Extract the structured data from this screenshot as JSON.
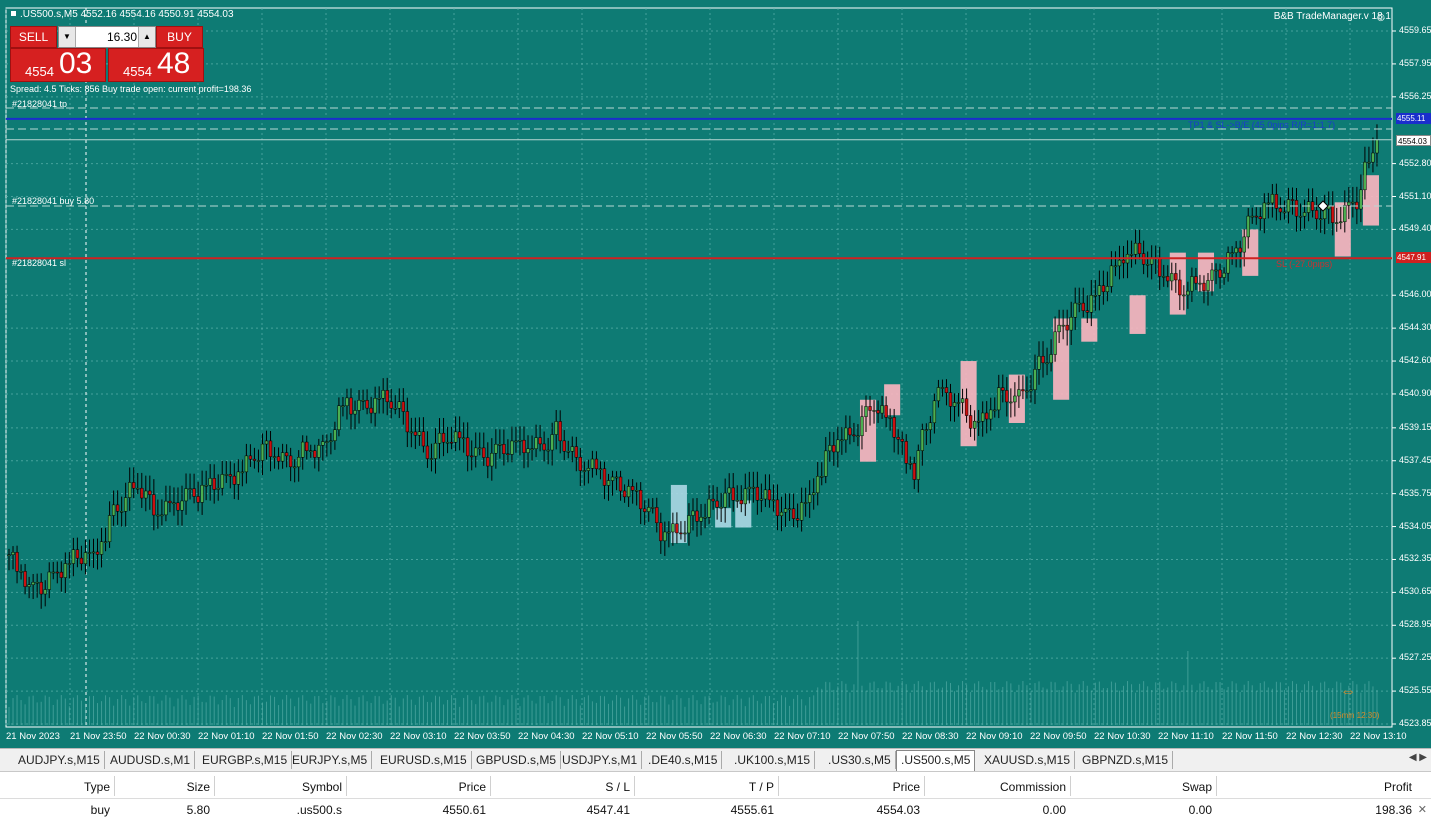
{
  "header": {
    "symbol_info": ".US500.s,M5  4552.16 4554.16 4550.91 4554.03",
    "trade_manager": "B&B TradeManager.v 18.1"
  },
  "one_click": {
    "sell_label": "SELL",
    "buy_label": "BUY",
    "volume": "16.30",
    "sell_price_small": "4554",
    "sell_price_big": "03",
    "buy_price_small": "4554",
    "buy_price_big": "48"
  },
  "status_line": "Spread: 4.5  Ticks: 856  Buy trade open: current profit=198.36",
  "line_labels": {
    "tp": "#21828041 tp",
    "buy": "#21828041 buy 5.80",
    "sl": "#21828041 sl",
    "tp_note": "TP1 & SL->B/E (45.0pips R/R=1:1.7)",
    "sl_note": "SL (-27.0pips)"
  },
  "price_tags": {
    "tp": "4555.11",
    "current": "4554.03",
    "sl": "4547.91"
  },
  "y_axis": [
    "4559.65",
    "4557.95",
    "4556.25",
    "4552.80",
    "4551.10",
    "4549.40",
    "4546.00",
    "4544.30",
    "4542.60",
    "4540.90",
    "4539.15",
    "4537.45",
    "4535.75",
    "4534.05",
    "4532.35",
    "4530.65",
    "4528.95",
    "4527.25",
    "4525.55",
    "4523.85"
  ],
  "x_axis": [
    "21 Nov 2023",
    "21 Nov 23:50",
    "22 Nov 00:30",
    "22 Nov 01:10",
    "22 Nov 01:50",
    "22 Nov 02:30",
    "22 Nov 03:10",
    "22 Nov 03:50",
    "22 Nov 04:30",
    "22 Nov 05:10",
    "22 Nov 05:50",
    "22 Nov 06:30",
    "22 Nov 07:10",
    "22 Nov 07:50",
    "22 Nov 08:30",
    "22 Nov 09:10",
    "22 Nov 09:50",
    "22 Nov 10:30",
    "22 Nov 11:10",
    "22 Nov 11:50",
    "22 Nov 12:30",
    "22 Nov 13:10"
  ],
  "corner_note": "(15min 12:30)",
  "colors": {
    "background": "#0e7b74",
    "bull": "#4caf50",
    "bear": "#cc1010",
    "tp_line": "#1a2ecc",
    "sl_line": "#d02020",
    "zone_pink": "#ffb6c1",
    "zone_blue": "#add8e6"
  },
  "tabs": [
    "AUDJPY.s,M15",
    "AUDUSD.s,M1",
    "EURGBP.s,M15",
    "EURJPY.s,M5",
    "EURUSD.s,M15",
    "GBPUSD.s,M5",
    "USDJPY.s,M1",
    ".DE40.s,M15",
    ".UK100.s,M15",
    ".US30.s,M5",
    ".US500.s,M5",
    "XAUUSD.s,M15",
    "GBPNZD.s,M15"
  ],
  "active_tab": ".US500.s,M5",
  "trade_table": {
    "headers": [
      "Type",
      "Size",
      "Symbol",
      "Price",
      "S / L",
      "T / P",
      "Price",
      "Commission",
      "Swap",
      "Profit"
    ],
    "row": [
      "buy",
      "5.80",
      ".us500.s",
      "4550.61",
      "4547.41",
      "4555.61",
      "4554.03",
      "0.00",
      "0.00",
      "198.36"
    ]
  },
  "chart_data": {
    "type": "candlestick",
    "y_range": [
      4523.85,
      4559.65
    ],
    "levels": {
      "tp": 4555.11,
      "current": 4554.03,
      "sl": 4547.91,
      "entry": 4550.61
    },
    "close_points": [
      [
        0,
        4532.3
      ],
      [
        4,
        4530.8
      ],
      [
        8,
        4531.6
      ],
      [
        12,
        4532.1
      ],
      [
        16,
        4532.4
      ],
      [
        20,
        4535.3
      ],
      [
        24,
        4535.8
      ],
      [
        28,
        4535.0
      ],
      [
        32,
        4535.6
      ],
      [
        36,
        4535.4
      ],
      [
        40,
        4536.4
      ],
      [
        44,
        4537.2
      ],
      [
        48,
        4537.8
      ],
      [
        52,
        4537.6
      ],
      [
        56,
        4538.2
      ],
      [
        60,
        4537.7
      ],
      [
        64,
        4540.6
      ],
      [
        68,
        4540.4
      ],
      [
        72,
        4540.4
      ],
      [
        76,
        4539.5
      ],
      [
        80,
        4538.2
      ],
      [
        84,
        4538.4
      ],
      [
        88,
        4538.0
      ],
      [
        92,
        4537.9
      ],
      [
        96,
        4537.8
      ],
      [
        100,
        4538.4
      ],
      [
        104,
        4539.2
      ],
      [
        108,
        4537.0
      ],
      [
        112,
        4537.2
      ],
      [
        116,
        4536.2
      ],
      [
        120,
        4535.0
      ],
      [
        124,
        4534.0
      ],
      [
        128,
        4534.2
      ],
      [
        132,
        4534.4
      ],
      [
        136,
        4536.0
      ],
      [
        140,
        4535.8
      ],
      [
        144,
        4535.2
      ],
      [
        148,
        4534.8
      ],
      [
        152,
        4535.4
      ],
      [
        156,
        4537.8
      ],
      [
        160,
        4539.2
      ],
      [
        164,
        4540.4
      ],
      [
        168,
        4538.8
      ],
      [
        172,
        4537.2
      ],
      [
        176,
        4540.8
      ],
      [
        180,
        4540.2
      ],
      [
        184,
        4539.6
      ],
      [
        188,
        4540.8
      ],
      [
        192,
        4540.4
      ],
      [
        196,
        4542.8
      ],
      [
        200,
        4544.2
      ],
      [
        204,
        4545.0
      ],
      [
        208,
        4546.8
      ],
      [
        212,
        4548.0
      ],
      [
        216,
        4547.8
      ],
      [
        220,
        4547.4
      ],
      [
        224,
        4546.2
      ],
      [
        228,
        4546.4
      ],
      [
        232,
        4548.2
      ],
      [
        236,
        4549.5
      ],
      [
        240,
        4550.6
      ],
      [
        244,
        4551.0
      ],
      [
        248,
        4550.2
      ],
      [
        252,
        4549.8
      ],
      [
        256,
        4551.2
      ],
      [
        260,
        4554.0
      ]
    ]
  }
}
